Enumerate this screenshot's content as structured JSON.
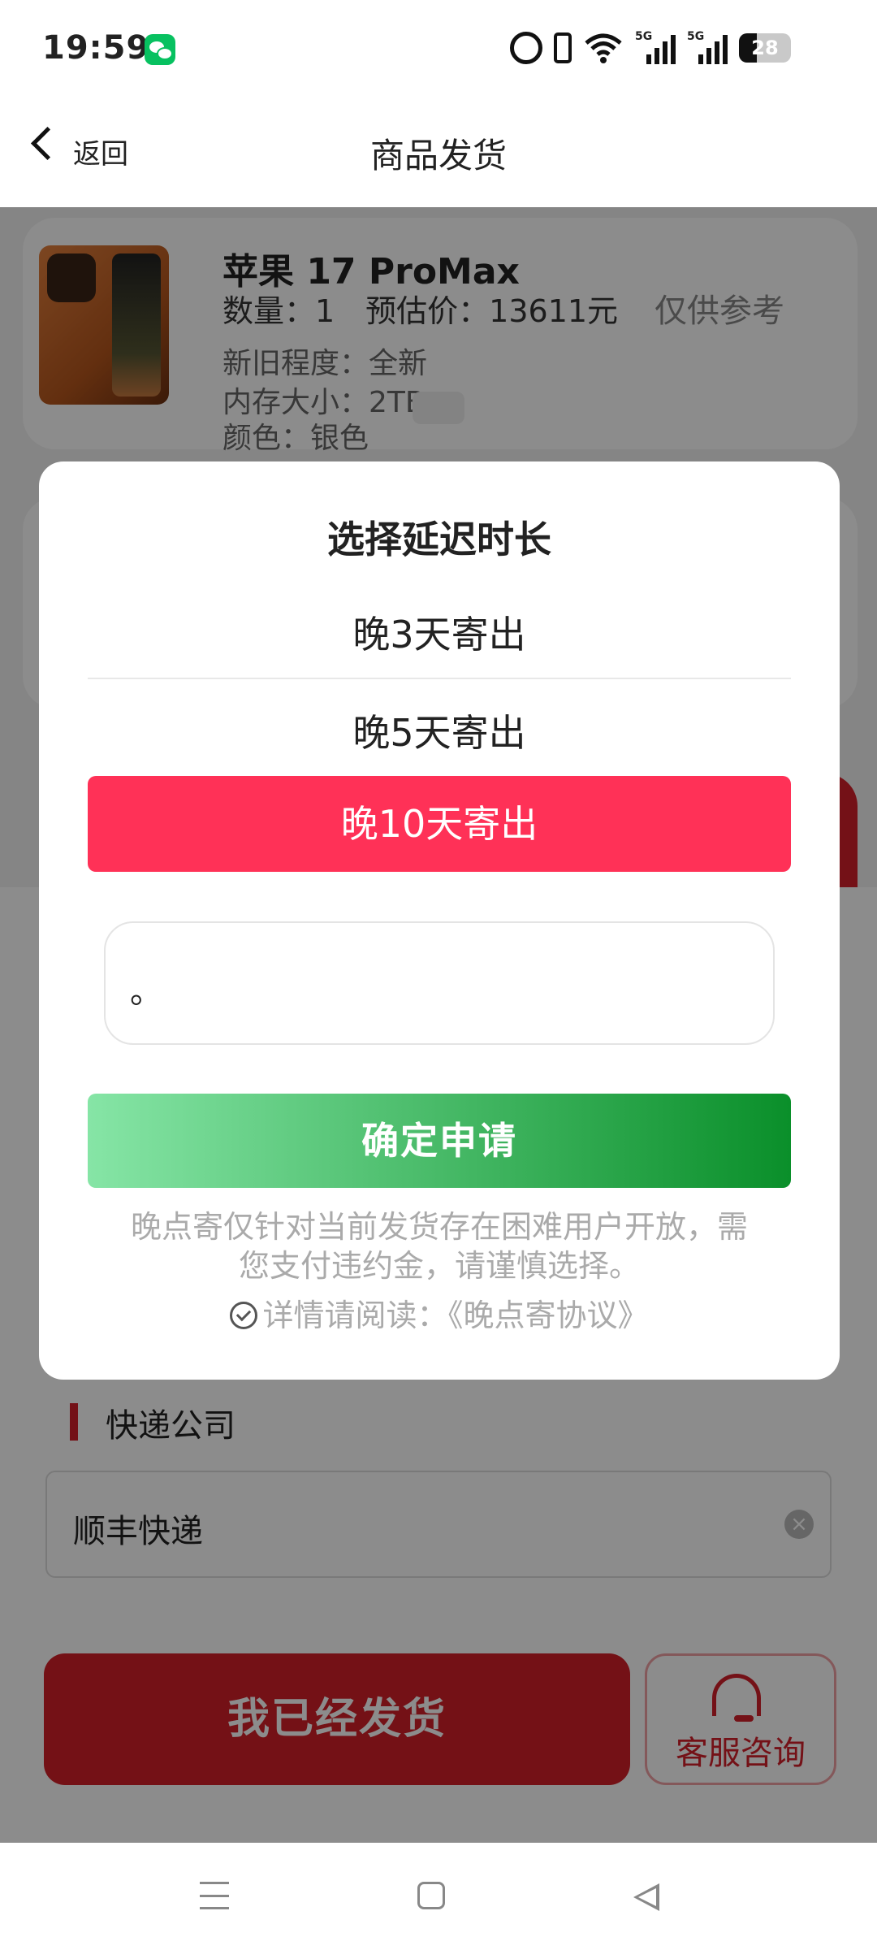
{
  "status_bar": {
    "time": "19:59",
    "battery": "28"
  },
  "header": {
    "back_label": "返回",
    "title": "商品发货"
  },
  "product": {
    "name": "苹果 17 ProMax",
    "quantity_line": "数量：1　预估价：13611元",
    "reference_note": "仅供参考",
    "condition": "新旧程度：全新",
    "storage": "内存大小：2TB",
    "color": "颜色：银色"
  },
  "modal": {
    "title": "选择延迟时长",
    "options": [
      "晚3天寄出",
      "晚5天寄出",
      "晚10天寄出"
    ],
    "selected_index": 2,
    "input_value": "。",
    "confirm_label": "确定申请",
    "note_line1": "晚点寄仅针对当前发货存在困难用户开放，需",
    "note_line2": "您支付违约金，请谨慎选择。",
    "agreement": "详情请阅读：《晚点寄协议》"
  },
  "express": {
    "label": "快递公司",
    "value": "顺丰快递"
  },
  "actions": {
    "shipped_label": "我已经发货",
    "service_label": "客服咨询"
  },
  "colors": {
    "accent_red": "#d4202a",
    "selected_option": "#ff3157",
    "confirm_green": "#0a8f2a"
  },
  "icons": [
    "wechat-icon",
    "alarm-icon",
    "vibrate-icon",
    "wifi-icon",
    "signal-icon",
    "battery-icon",
    "back-chevron-icon",
    "chevron-down-icon",
    "check-circle-icon",
    "clear-icon",
    "headset-icon",
    "menu-icon",
    "home-icon",
    "back-triangle-icon"
  ]
}
